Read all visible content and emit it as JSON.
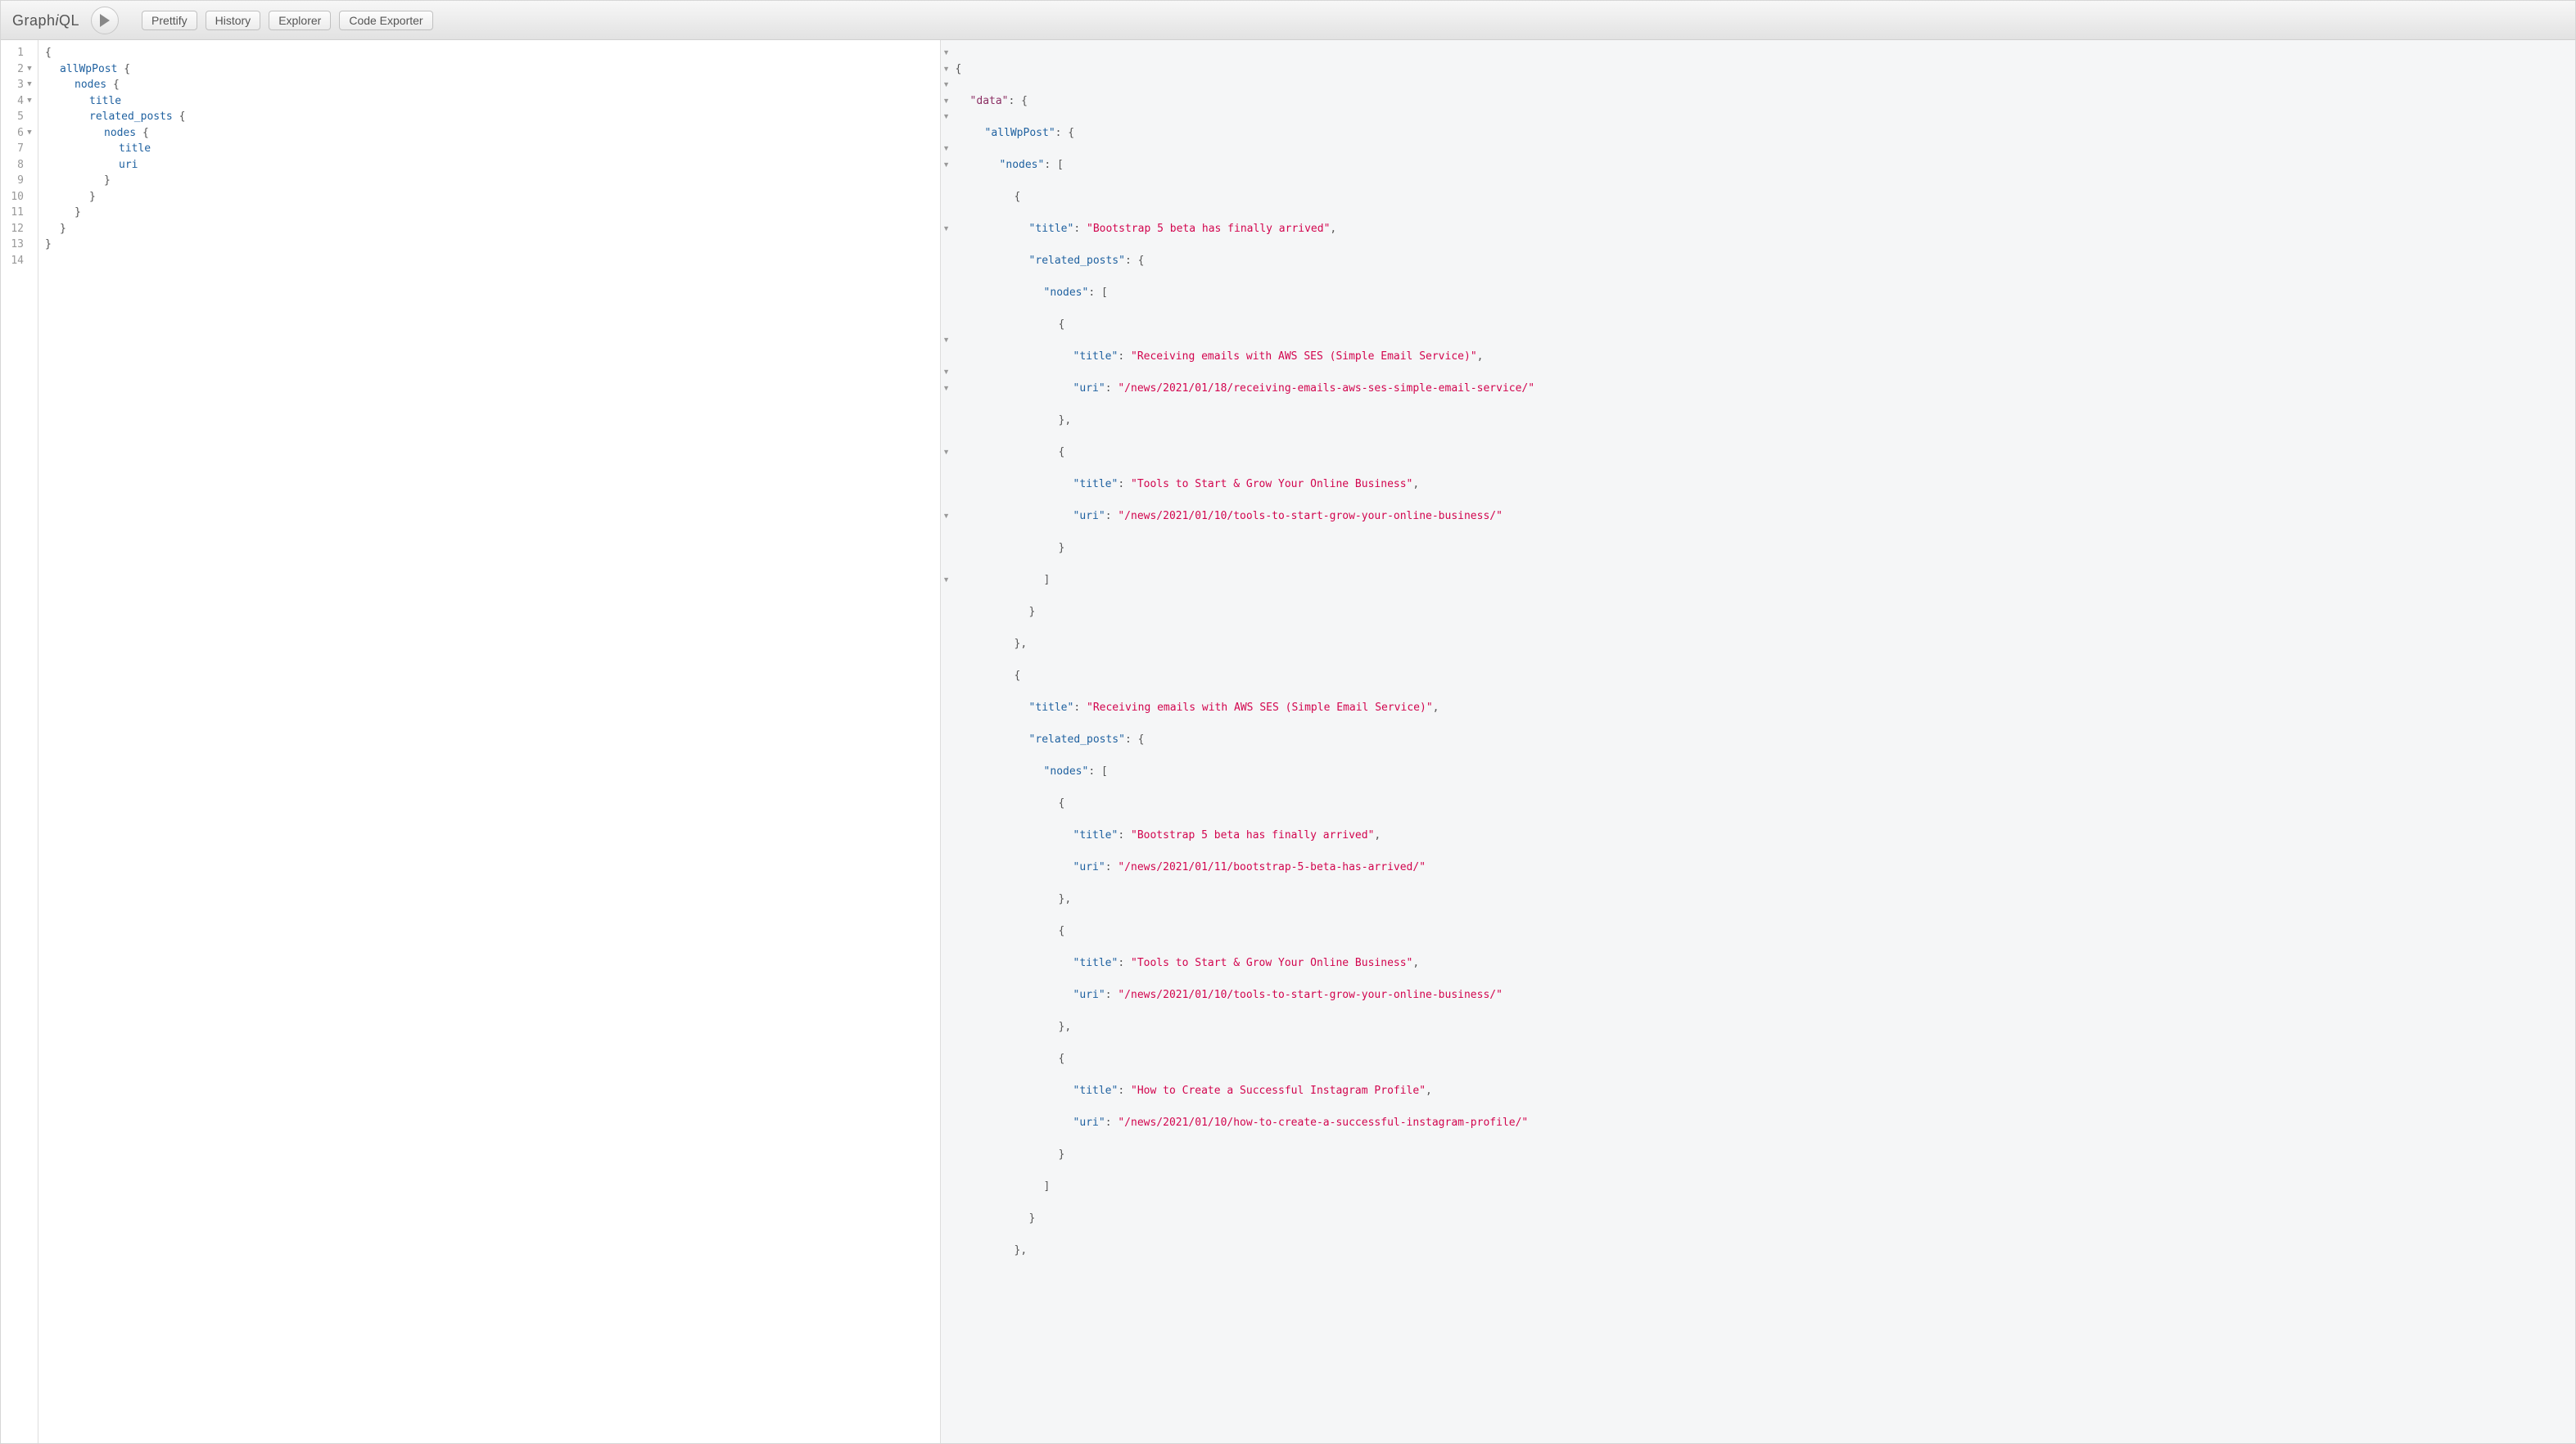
{
  "toolbar": {
    "title_plain1": "Graph",
    "title_em": "i",
    "title_plain2": "QL",
    "prettify": "Prettify",
    "history": "History",
    "explorer": "Explorer",
    "code_exporter": "Code Exporter"
  },
  "query": {
    "lines": [
      "1",
      "2",
      "3",
      "4",
      "5",
      "6",
      "7",
      "8",
      "9",
      "10",
      "11",
      "12",
      "13",
      "14"
    ],
    "foldable": [
      false,
      true,
      true,
      true,
      false,
      true,
      false,
      false,
      false,
      false,
      false,
      false,
      false,
      false
    ],
    "tokens": {
      "brace_open": "{",
      "brace_close": "}",
      "allWpPost": "allWpPost",
      "nodes": "nodes",
      "title": "title",
      "related_posts": "related_posts",
      "uri": "uri"
    }
  },
  "result": {
    "keys": {
      "data": "\"data\"",
      "allWpPost": "\"allWpPost\"",
      "nodes": "\"nodes\"",
      "title": "\"title\"",
      "related_posts": "\"related_posts\"",
      "uri": "\"uri\""
    },
    "values": {
      "post1_title": "\"Bootstrap 5 beta has finally arrived\"",
      "post1_rel1_title": "\"Receiving emails with AWS SES (Simple Email Service)\"",
      "post1_rel1_uri": "\"/news/2021/01/18/receiving-emails-aws-ses-simple-email-service/\"",
      "post1_rel2_title": "\"Tools to Start & Grow Your Online Business\"",
      "post1_rel2_uri": "\"/news/2021/01/10/tools-to-start-grow-your-online-business/\"",
      "post2_title": "\"Receiving emails with AWS SES (Simple Email Service)\"",
      "post2_rel1_title": "\"Bootstrap 5 beta has finally arrived\"",
      "post2_rel1_uri": "\"/news/2021/01/11/bootstrap-5-beta-has-arrived/\"",
      "post2_rel2_title": "\"Tools to Start & Grow Your Online Business\"",
      "post2_rel2_uri": "\"/news/2021/01/10/tools-to-start-grow-your-online-business/\"",
      "post2_rel3_title": "\"How to Create a Successful Instagram Profile\"",
      "post2_rel3_uri": "\"/news/2021/01/10/how-to-create-a-successful-instagram-profile/\""
    },
    "fold_rows": [
      true,
      true,
      true,
      true,
      true,
      false,
      true,
      true,
      false,
      false,
      false,
      true,
      false,
      false,
      false,
      false,
      false,
      false,
      true,
      false,
      true,
      true,
      false,
      false,
      false,
      true,
      false,
      false,
      false,
      true,
      false,
      false,
      false,
      true,
      false,
      false,
      false,
      false,
      false
    ]
  }
}
